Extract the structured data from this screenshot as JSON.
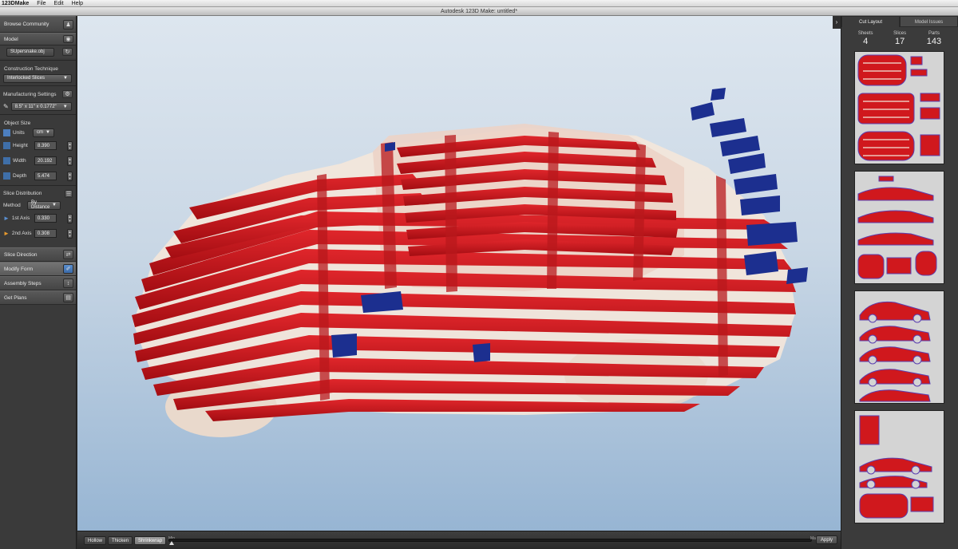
{
  "menubar": {
    "app_name": "123DMake",
    "items": [
      "File",
      "Edit",
      "Help"
    ]
  },
  "window": {
    "title": "Autodesk 123D Make: untitled*"
  },
  "left_panel": {
    "browse_community": "Browse Community",
    "model_label": "Model",
    "model_file": "SUpersnake.obj",
    "construction_label": "Construction Technique",
    "construction_value": "Interlocked Slices",
    "manufacturing_label": "Manufacturing Settings",
    "manufacturing_value": "8.5\" x 11\" x 0.1772\"",
    "object_size_label": "Object Size",
    "units_label": "Units",
    "units_value": "cm",
    "height_label": "Height",
    "height_value": "8.390",
    "width_label": "Width",
    "width_value": "20.192",
    "depth_label": "Depth",
    "depth_value": "5.474",
    "slice_distribution_label": "Slice Distribution",
    "method_label": "Method",
    "method_value": "By Distance",
    "axis1_label": "1st Axis",
    "axis1_value": "0.330",
    "axis2_label": "2nd Axis",
    "axis2_value": "0.308",
    "slice_direction": "Slice Direction",
    "modify_form": "Modify Form",
    "assembly_steps": "Assembly Steps",
    "get_plans": "Get Plans"
  },
  "bottom_toolbar": {
    "hollow": "Hollow",
    "thicken": "Thicken",
    "shrinkwrap": "Shrinkwrap",
    "min_label": "Min",
    "max_label": "Max",
    "apply": "Apply"
  },
  "right_panel": {
    "tab_cut_layout": "Cut Layout",
    "tab_model_issues": "Model Issues",
    "sheets_label": "Sheets",
    "sheets_value": "4",
    "slices_label": "Slices",
    "slices_value": "17",
    "parts_label": "Parts",
    "parts_value": "143"
  },
  "colors": {
    "slice_red": "#c8141a",
    "slice_blue": "#1c2f8f",
    "part_cream": "#f3e6da",
    "viewport_top": "#dde6ef",
    "viewport_bottom": "#97b5d3"
  }
}
